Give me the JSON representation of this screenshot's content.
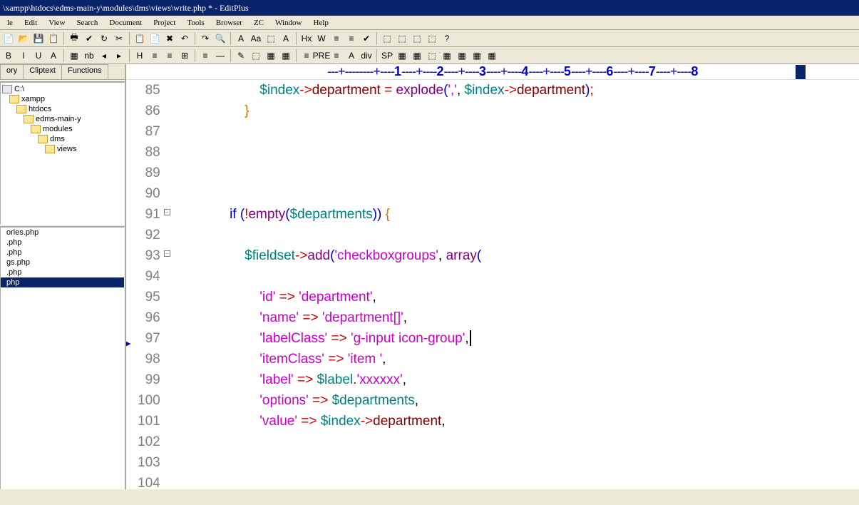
{
  "title": "\\xampp\\htdocs\\edms-main-y\\modules\\dms\\views\\write.php * - EditPlus",
  "menu": [
    "le",
    "Edit",
    "View",
    "Search",
    "Document",
    "Project",
    "Tools",
    "Browser",
    "ZC",
    "Window",
    "Help"
  ],
  "tabs": [
    "ory",
    "Cliptext",
    "Functions"
  ],
  "tree": [
    {
      "label": "C:\\",
      "icon": "drive",
      "indent": 0
    },
    {
      "label": "xampp",
      "icon": "folder",
      "indent": 1
    },
    {
      "label": "htdocs",
      "icon": "folder",
      "indent": 2
    },
    {
      "label": "edms-main-y",
      "icon": "folder",
      "indent": 3
    },
    {
      "label": "modules",
      "icon": "folder",
      "indent": 4
    },
    {
      "label": "dms",
      "icon": "folder",
      "indent": 5
    },
    {
      "label": "views",
      "icon": "folder",
      "indent": 6
    }
  ],
  "files": [
    {
      "name": "ories.php",
      "sel": false
    },
    {
      "name": ".php",
      "sel": false
    },
    {
      "name": ".php",
      "sel": false
    },
    {
      "name": "gs.php",
      "sel": false
    },
    {
      "name": ".php",
      "sel": false
    },
    {
      "name": "php",
      "sel": true
    }
  ],
  "ruler": {
    "start": 1,
    "end": 8,
    "caret_col": 6
  },
  "lines": [
    {
      "n": 85,
      "html": "                    <span class='c-var'>$index</span><span class='c-op'>-&gt;</span><span class='c-txt'>department </span><span class='c-op'>=</span> <span class='c-func'>explode</span><span class='c-paren'>(</span><span class='c-str'>','</span><span class='c-comma'>,</span> <span class='c-var'>$index</span><span class='c-op'>-&gt;</span><span class='c-txt'>department</span><span class='c-paren'>)</span><span class='c-punc'>;</span>"
    },
    {
      "n": 86,
      "html": "                <span class='c-brace'>}</span>"
    },
    {
      "n": 87,
      "html": ""
    },
    {
      "n": 88,
      "html": ""
    },
    {
      "n": 89,
      "html": ""
    },
    {
      "n": 90,
      "html": ""
    },
    {
      "n": 91,
      "fold": true,
      "html": "            <span class='c-kw'>if</span> <span class='c-paren'>(</span><span class='c-op'>!</span><span class='c-func'>empty</span><span class='c-paren'>(</span><span class='c-var'>$departments</span><span class='c-paren'>)</span><span class='c-paren'>)</span> <span class='c-brace'>{</span>"
    },
    {
      "n": 92,
      "html": ""
    },
    {
      "n": 93,
      "fold": true,
      "html": "                <span class='c-var'>$fieldset</span><span class='c-op'>-&gt;</span><span class='c-func'>add</span><span class='c-paren'>(</span><span class='c-str'>'checkboxgroups'</span><span class='c-comma'>,</span> <span class='c-func'>array</span><span class='c-paren'>(</span>"
    },
    {
      "n": 94,
      "html": ""
    },
    {
      "n": 95,
      "html": "                    <span class='c-str'>'id'</span> <span class='c-op'>=&gt;</span> <span class='c-str'>'department'</span><span class='c-comma'>,</span>"
    },
    {
      "n": 96,
      "html": "                    <span class='c-str'>'name'</span> <span class='c-op'>=&gt;</span> <span class='c-str'>'department[]'</span><span class='c-comma'>,</span>"
    },
    {
      "n": 97,
      "ptr": true,
      "html": "                    <span class='c-str'>'labelClass'</span> <span class='c-op'>=&gt;</span> <span class='c-str'>'g-input icon-group'</span><span class='c-comma'>,</span><span class='cursor'></span>"
    },
    {
      "n": 98,
      "html": "                    <span class='c-str'>'itemClass'</span> <span class='c-op'>=&gt;</span> <span class='c-str'>'item '</span><span class='c-comma'>,</span>"
    },
    {
      "n": 99,
      "html": "                    <span class='c-str'>'label'</span> <span class='c-op'>=&gt;</span> <span class='c-var'>$label</span><span class='c-dot'>.</span><span class='c-str'>'xxxxxx'</span><span class='c-comma'>,</span>"
    },
    {
      "n": 100,
      "html": "                    <span class='c-str'>'options'</span> <span class='c-op'>=&gt;</span> <span class='c-var'>$departments</span><span class='c-comma'>,</span>"
    },
    {
      "n": 101,
      "html": "                    <span class='c-str'>'value'</span> <span class='c-op'>=&gt;</span> <span class='c-var'>$index</span><span class='c-op'>-&gt;</span><span class='c-txt'>department</span><span class='c-comma'>,</span>"
    },
    {
      "n": 102,
      "html": ""
    },
    {
      "n": 103,
      "html": ""
    },
    {
      "n": 104,
      "html": ""
    }
  ],
  "toolbar1": [
    "📄",
    "📂",
    "💾",
    "📋",
    "🖶",
    "✔",
    "↻",
    "✂",
    "📋",
    "📄",
    "✖",
    "↶",
    "↷",
    "🔍",
    "A",
    "Aa",
    "⬚",
    "A",
    "Hx",
    "W",
    "≡",
    "≡",
    "✔",
    "⬚",
    "⬚",
    "⬚",
    "⬚",
    "?"
  ],
  "toolbar2": [
    "B",
    "I",
    "U",
    "A",
    "▦",
    "nb",
    "◂",
    "▸",
    "H",
    "≡",
    "≡",
    "⊞",
    "≡",
    "—",
    "✎",
    "⬚",
    "▦",
    "▦",
    "≡",
    "PRE",
    "≡",
    "A",
    "div",
    "SP",
    "▦",
    "▦",
    "⬚",
    "▦",
    "▦",
    "▦",
    "▦"
  ]
}
